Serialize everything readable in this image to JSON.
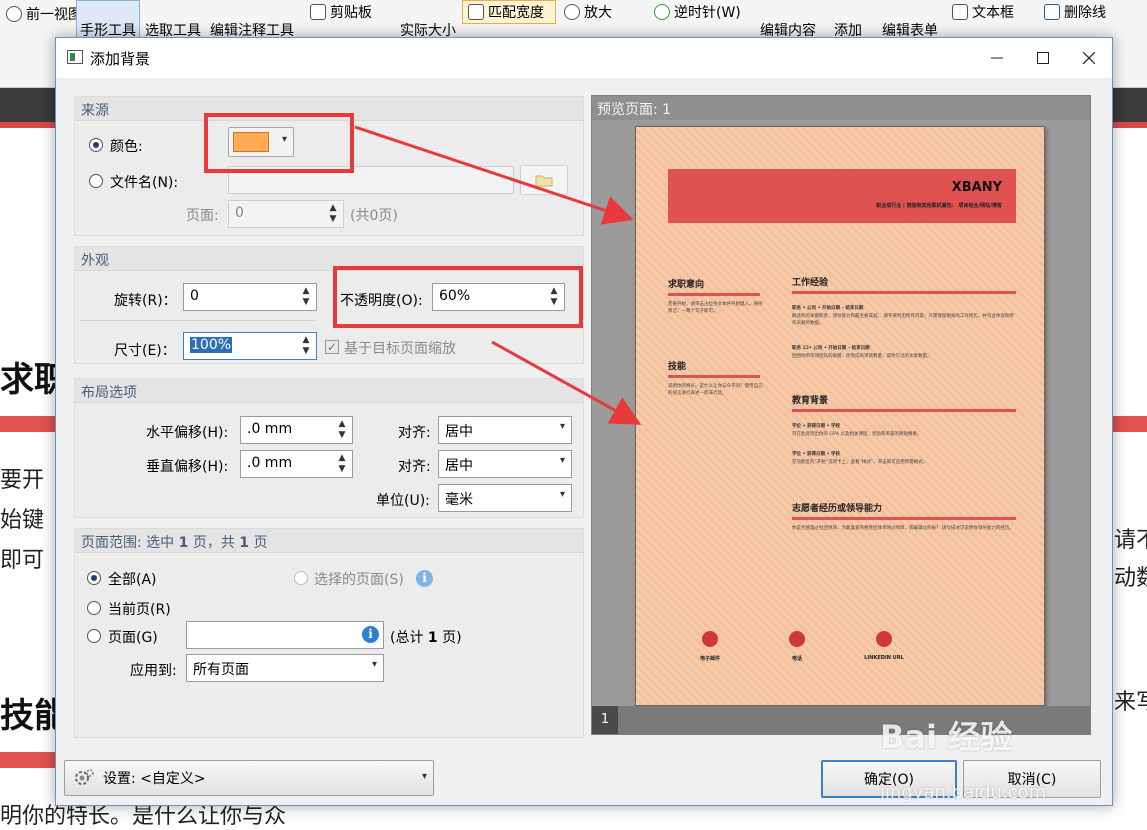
{
  "app_toolbar": {
    "items": [
      "前一视图",
      "手形工具",
      "选取工具",
      "编辑注释工具",
      "剪贴板",
      "实际大小",
      "匹配宽度",
      "放大",
      "逆时针(W)",
      "编辑内容",
      "添加",
      "编辑表单",
      "文本框",
      "删除线"
    ]
  },
  "background_doc": {
    "heading_1": "求职",
    "heading_2": "技能",
    "line_1": "要开",
    "line_2": "始键",
    "line_3": "即可",
    "line_4": "明你的特长。是什么让你与众",
    "right_1": "请不",
    "right_2": "动数",
    "right_3": "来写"
  },
  "dialog": {
    "title": "添加背景",
    "source": {
      "header": "来源",
      "color_label": "颜色:",
      "color_value": "#ffaa55",
      "file_label": "文件名(N):",
      "page_label": "页面:",
      "page_value": "0",
      "page_total": "(共0页)"
    },
    "appearance": {
      "header": "外观",
      "rotate_label": "旋转(R)：",
      "rotate_value": "0",
      "opacity_label": "不透明度(O):",
      "opacity_value": "60%",
      "size_label": "尺寸(E)：",
      "size_value": "100%",
      "scale_label": "基于目标页面缩放"
    },
    "layout": {
      "header": "布局选项",
      "h_offset_label": "水平偏移(H):",
      "h_offset_value": ".0 mm",
      "v_offset_label": "垂直偏移(H):",
      "v_offset_value": ".0 mm",
      "align_label": "对齐:",
      "h_align_value": "居中",
      "v_align_value": "居中",
      "unit_label": "单位(U):",
      "unit_value": "毫米"
    },
    "page_range": {
      "header_prefix": "页面范围: 选中",
      "header_selected": "1",
      "header_mid": "页，共",
      "header_total": "1",
      "header_suffix": "页",
      "all_label": "全部(A)",
      "selected_pages_label": "选择的页面(S)",
      "current_label": "当前页(R)",
      "pages_label": "页面(G)",
      "pages_total_prefix": "(总计",
      "pages_total_count": "1",
      "pages_total_suffix": "页)",
      "apply_label": "应用到:",
      "apply_value": "所有页面"
    },
    "preview": {
      "header": "预览页面: 1",
      "page_number": "1"
    },
    "settings_label": "设置: <自定义>",
    "ok_label": "确定(O)",
    "cancel_label": "取消(C)"
  },
  "resume": {
    "name": "XBANY",
    "banner_subtitle": "职业或行业 | 链接到其他联机属性： 项目组合/网站/博客",
    "objective_head": "求职意向",
    "objective_text": "若要开始，请单击占位符文本并开始键入。保持简洁：一两个句子即可。",
    "skills_head": "技能",
    "skills_text": "说明你的特长。是什么让你与众不同？使用自己的语言进行表述—而非行话。",
    "work_head": "工作经验",
    "job1": "职务 • 公司 • 开始日期 – 结束日期",
    "job1_text": "概述你的关键职责、领导能力和最主要成就。 请不要列出所有内容；只需保留相关的工作经历，并包含体现你所作贡献的数据。",
    "job2": "职务 22• 公司 • 开始日期 – 结束日期",
    "job2_text": "回想你所带领团队的规模、你完成的项目数量，或你写过的文章数量。",
    "edu_head": "教育背景",
    "edu1": "学位 • 获得日期 • 学校",
    "edu1_text": "可在此处列出你的 GPA 以及相关课程、奖励和荣誉的简短摘要。",
    "edu2": "学位 • 获得日期 • 学校",
    "edu2_text": "在功能区的“开始”选项卡上，查看“样式”，单击即可应用所需格式。",
    "volunteer_head": "志愿者经历或领导能力",
    "volunteer_text": "你是否管理过社团项目、为最喜爱的慈善团体带领过项目，或编辑过校报？ 请写描述可说明你领导能力的经历。",
    "email_label": "电子邮件",
    "phone_label": "电话",
    "linkedin_label": "LINKEDIN URL"
  },
  "watermark": {
    "main": "Bai 经验",
    "sub": "jingyan.baidu.com"
  },
  "colors": {
    "annotation_red": "#e73a3a",
    "page_bg": "#f4c09a",
    "resume_accent": "#e05252"
  }
}
